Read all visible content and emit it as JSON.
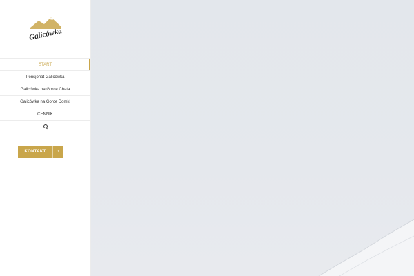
{
  "logo": {
    "text": "Galicówka",
    "icon": "mountain-logo-icon"
  },
  "nav": {
    "items": [
      {
        "label": "START",
        "active": true
      },
      {
        "label": "Pensjonat Galicówka",
        "active": false
      },
      {
        "label": "Galicówka na Gorce Chata",
        "active": false
      },
      {
        "label": "Galicówka na Gorce Domki",
        "active": false
      },
      {
        "label": "CENNIK",
        "active": false
      }
    ],
    "search_icon": "search-icon"
  },
  "contact": {
    "label": "KONTAKT",
    "arrow": "›"
  },
  "colors": {
    "accent": "#c9a64b",
    "hero_sky": "#e4e8ed"
  }
}
